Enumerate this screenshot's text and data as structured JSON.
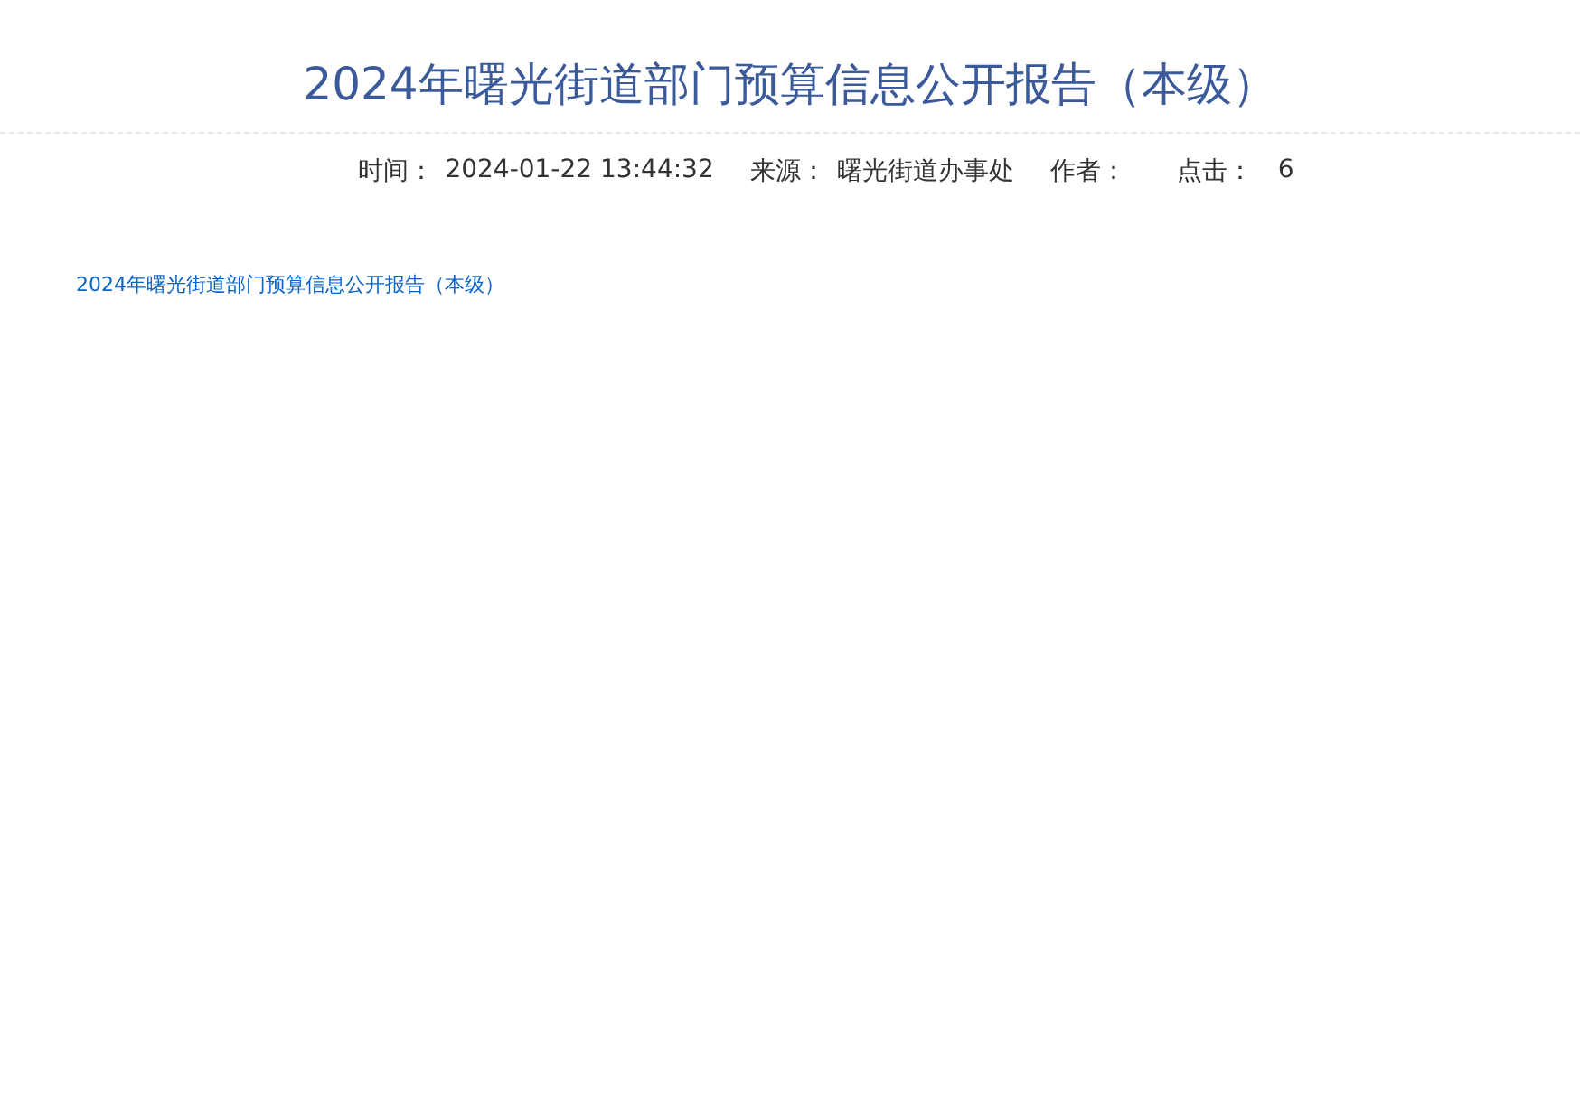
{
  "article": {
    "title": "2024年曙光街道部门预算信息公开报告（本级）",
    "meta": [
      {
        "label": "时间：",
        "value": "2024-01-22 13:44:32"
      },
      {
        "label": "来源：",
        "value": "曙光街道办事处"
      },
      {
        "label": "作者："
      },
      {
        "label": "点击：",
        "value": "6"
      }
    ],
    "attachment_link": "2024年曙光街道部门预算信息公开报告（本级）"
  }
}
